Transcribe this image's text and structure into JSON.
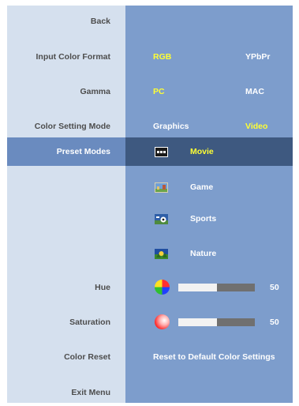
{
  "menu": {
    "back": "Back",
    "input_color_format": {
      "label": "Input Color Format",
      "options": [
        "RGB",
        "YPbPr"
      ],
      "selected": "RGB"
    },
    "gamma": {
      "label": "Gamma",
      "options": [
        "PC",
        "MAC"
      ],
      "selected": "PC"
    },
    "color_setting_mode": {
      "label": "Color Setting Mode",
      "options": [
        "Graphics",
        "Video"
      ],
      "selected": "Video"
    },
    "preset_modes": {
      "label": "Preset Modes",
      "items": [
        {
          "label": "Movie",
          "icon": "movie-icon",
          "selected": true
        },
        {
          "label": "Game",
          "icon": "game-icon"
        },
        {
          "label": "Sports",
          "icon": "sports-icon"
        },
        {
          "label": "Nature",
          "icon": "nature-icon"
        }
      ]
    },
    "hue": {
      "label": "Hue",
      "value": "50",
      "level": 0.5,
      "icon": "hue-color-wheel-icon"
    },
    "saturation": {
      "label": "Saturation",
      "value": "50",
      "level": 0.5,
      "icon": "saturation-icon"
    },
    "color_reset": {
      "label": "Color Reset",
      "action": "Reset to Default Color Settings"
    },
    "exit": "Exit Menu"
  },
  "colors": {
    "left_panel": "#d5e0ee",
    "right_panel": "#7d9dcc",
    "selected_row": "#6a8bbf",
    "selected_right": "#3e5980",
    "active_text": "#ffff33",
    "text": "#4d4d4d"
  }
}
